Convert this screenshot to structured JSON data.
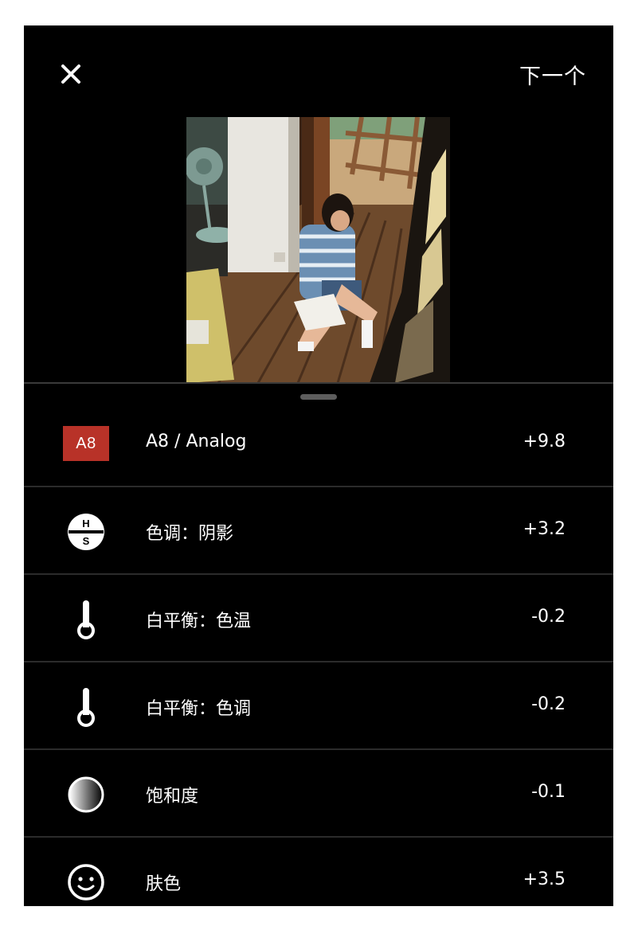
{
  "header": {
    "next_label": "下一个"
  },
  "edits": [
    {
      "icon": "a8-preset-badge",
      "badge_text": "A8",
      "label": "A8 / Analog",
      "value": "+9.8",
      "badge_color": "#b83228"
    },
    {
      "icon": "hsl-icon",
      "icon_letters": [
        "H",
        "S"
      ],
      "label": "色调：阴影",
      "value": "+3.2"
    },
    {
      "icon": "thermometer-icon",
      "label": "白平衡：色温",
      "value": "-0.2"
    },
    {
      "icon": "thermometer-icon",
      "label": "白平衡：色调",
      "value": "-0.2"
    },
    {
      "icon": "saturation-gradient-icon",
      "label": "饱和度",
      "value": "-0.1"
    },
    {
      "icon": "smiley-face-icon",
      "label": "肤色",
      "value": "+3.5"
    }
  ]
}
